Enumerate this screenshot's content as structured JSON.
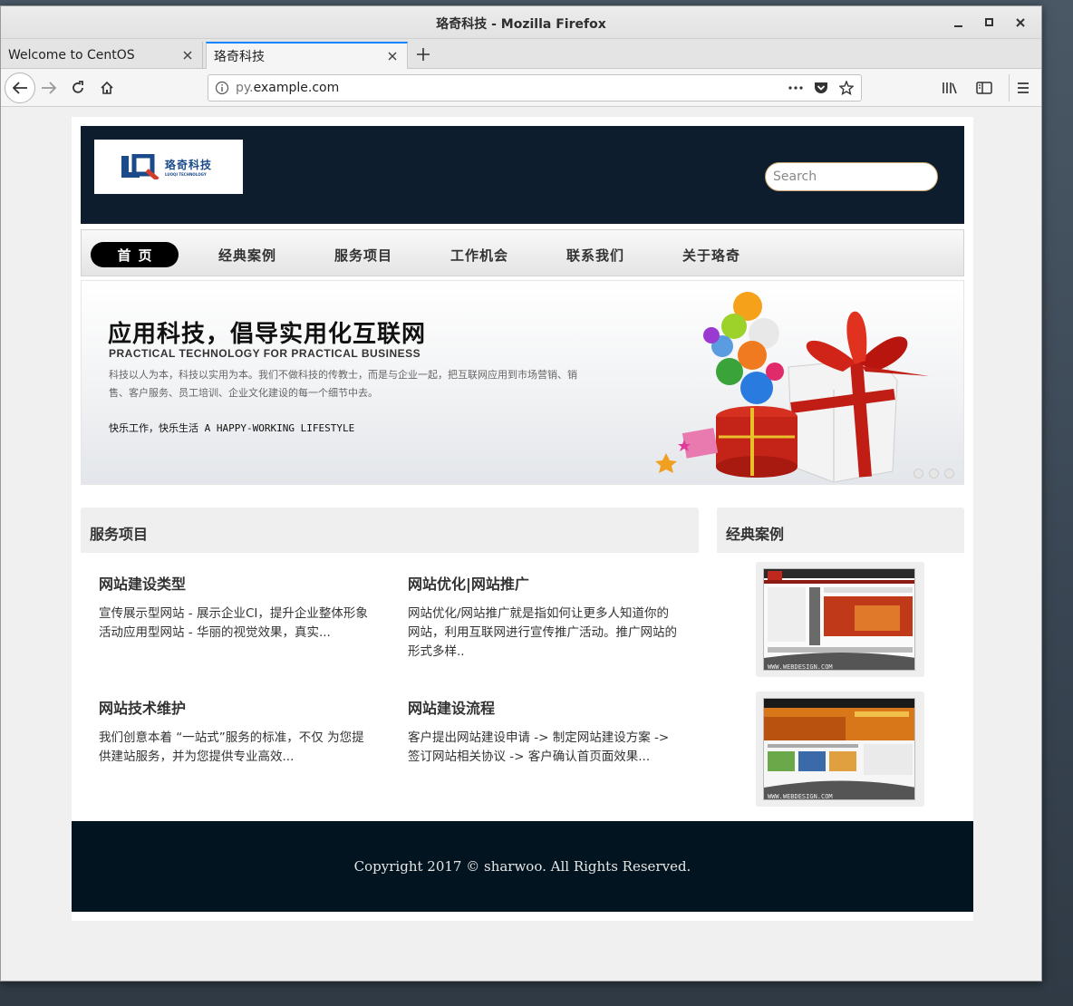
{
  "window": {
    "title": "珞奇科技 - Mozilla Firefox"
  },
  "tabs": [
    {
      "label": "Welcome to CentOS"
    },
    {
      "label": "珞奇科技"
    }
  ],
  "urlbar": {
    "prefix": "py.",
    "domain": "example.com"
  },
  "site": {
    "logo_cn": "珞奇科技",
    "logo_en": "LUOQI TECHNOLOGY",
    "search_placeholder": "Search",
    "nav": [
      "首页",
      "经典案例",
      "服务项目",
      "工作机会",
      "联系我们",
      "关于珞奇"
    ],
    "active_nav": "首页"
  },
  "banner": {
    "title": "应用科技，倡导实用化互联网",
    "subtitle": "PRACTICAL TECHNOLOGY FOR PRACTICAL BUSINESS",
    "desc": "科技以人为本，科技以实用为本。我们不做科技的传教士，而是与企业一起，把互联网应用到市场营销、销售、客户服务、员工培训、企业文化建设的每一个细节中去。",
    "motto": "快乐工作，快乐生活 A HAPPY-WORKING LIFESTYLE"
  },
  "services": {
    "heading": "服务项目",
    "items": [
      {
        "title": "网站建设类型",
        "text": "宣传展示型网站 - 展示企业CI，提升企业整体形象 活动应用型网站 - 华丽的视觉效果，真实..."
      },
      {
        "title": "网站优化|网站推广",
        "text": "网站优化/网站推广就是指如何让更多人知道你的网站，利用互联网进行宣传推广活动。推广网站的形式多样.."
      },
      {
        "title": "网站技术维护",
        "text": "我们创意本着 “一站式”服务的标准，不仅 为您提供建站服务，并为您提供专业高效..."
      },
      {
        "title": "网站建设流程",
        "text": "客户提出网站建设申请 -> 制定网站建设方案 -> 签订网站相关协议 -> 客户确认首页面效果..."
      }
    ]
  },
  "cases": {
    "heading": "经典案例",
    "watermark": "WWW.WEBDESIGN.COM"
  },
  "footer": {
    "copyright": "Copyright 2017 © sharwoo. All Rights Reserved."
  },
  "colors": {
    "header_bg": "#0d1d2e",
    "footer_bg": "#02141f",
    "active_tab_accent": "#0a84ff"
  }
}
